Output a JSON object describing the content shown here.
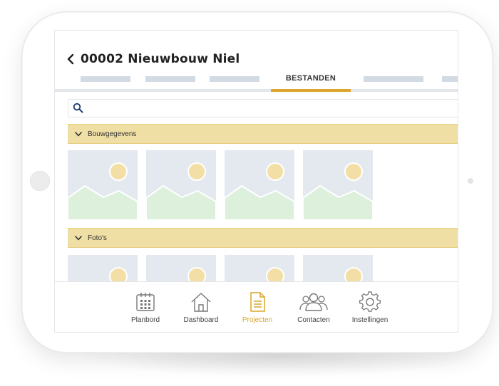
{
  "header": {
    "title": "00002 Nieuwbouw Niel"
  },
  "tabs": {
    "active_label": "BESTANDEN"
  },
  "search": {
    "placeholder": "",
    "value": ""
  },
  "sections": [
    {
      "label": "Bouwgegevens",
      "thumbnail_count": 4
    },
    {
      "label": "Foto's",
      "thumbnail_count": 4
    }
  ],
  "bottom_nav": [
    {
      "label": "Planbord",
      "icon": "calendar-icon",
      "active": false
    },
    {
      "label": "Dashboard",
      "icon": "home-icon",
      "active": false
    },
    {
      "label": "Projecten",
      "icon": "document-icon",
      "active": true
    },
    {
      "label": "Contacten",
      "icon": "people-icon",
      "active": false
    },
    {
      "label": "Instellingen",
      "icon": "gear-icon",
      "active": false
    }
  ],
  "colors": {
    "accent": "#dba72c",
    "section_header": "#f0dfa4",
    "thumb_bg": "#e4e8ef",
    "thumb_sun": "#f3dfa5",
    "thumb_hill": "#dcf0dc",
    "tab_placeholder": "#d2dae3"
  }
}
